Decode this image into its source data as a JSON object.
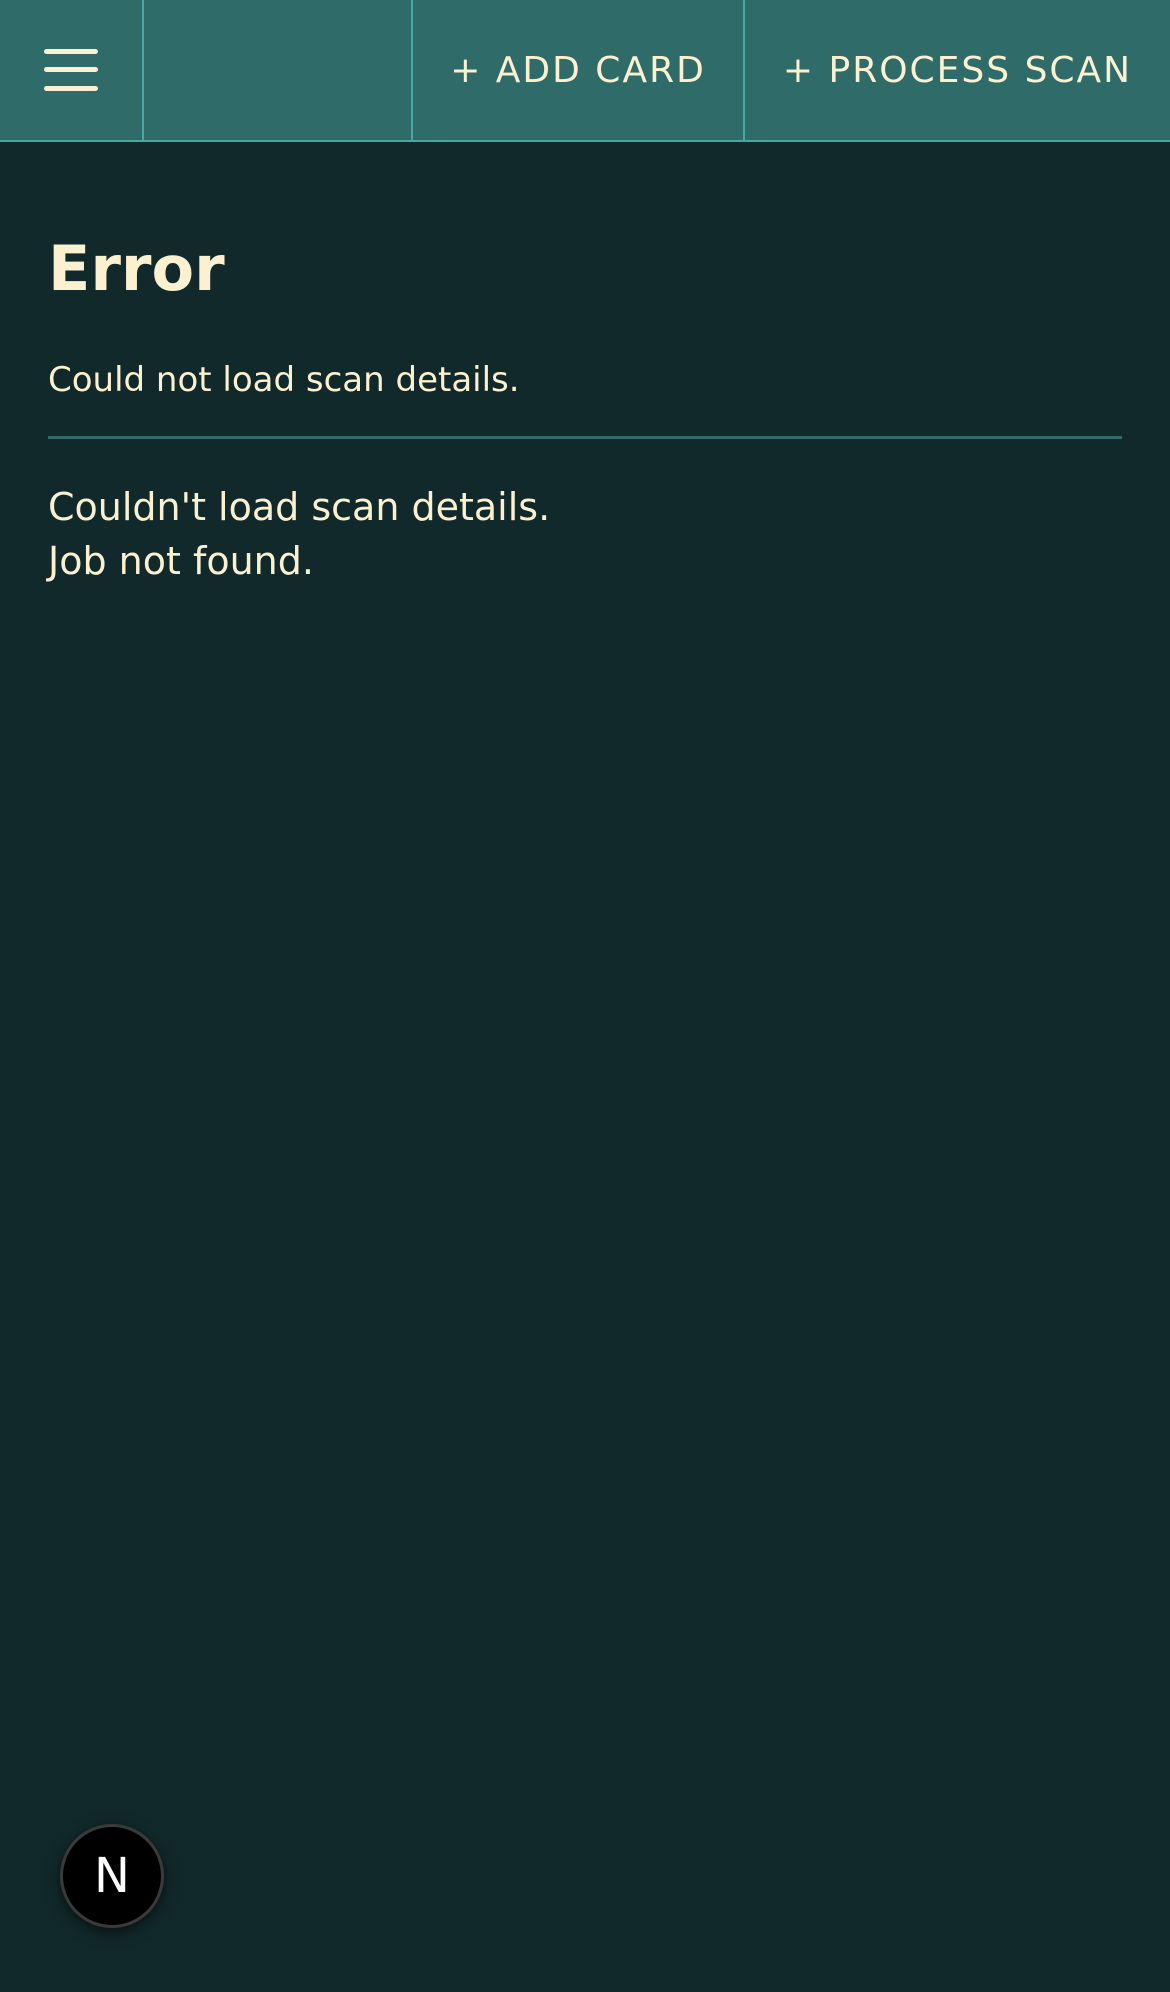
{
  "header": {
    "menu_icon": "hamburger-menu-icon",
    "add_card_label": "+ ADD CARD",
    "process_scan_label": "+ PROCESS SCAN"
  },
  "main": {
    "title": "Error",
    "subtitle": "Could not load scan details.",
    "message_line1": "Couldn't load scan details.",
    "message_line2": "Job not found."
  },
  "dev_badge": {
    "letter": "N"
  },
  "colors": {
    "background": "#11292b",
    "header": "#2e6b69",
    "header_border": "#49a8a1",
    "text": "#fbf1d0",
    "divider": "#2e6b69"
  }
}
